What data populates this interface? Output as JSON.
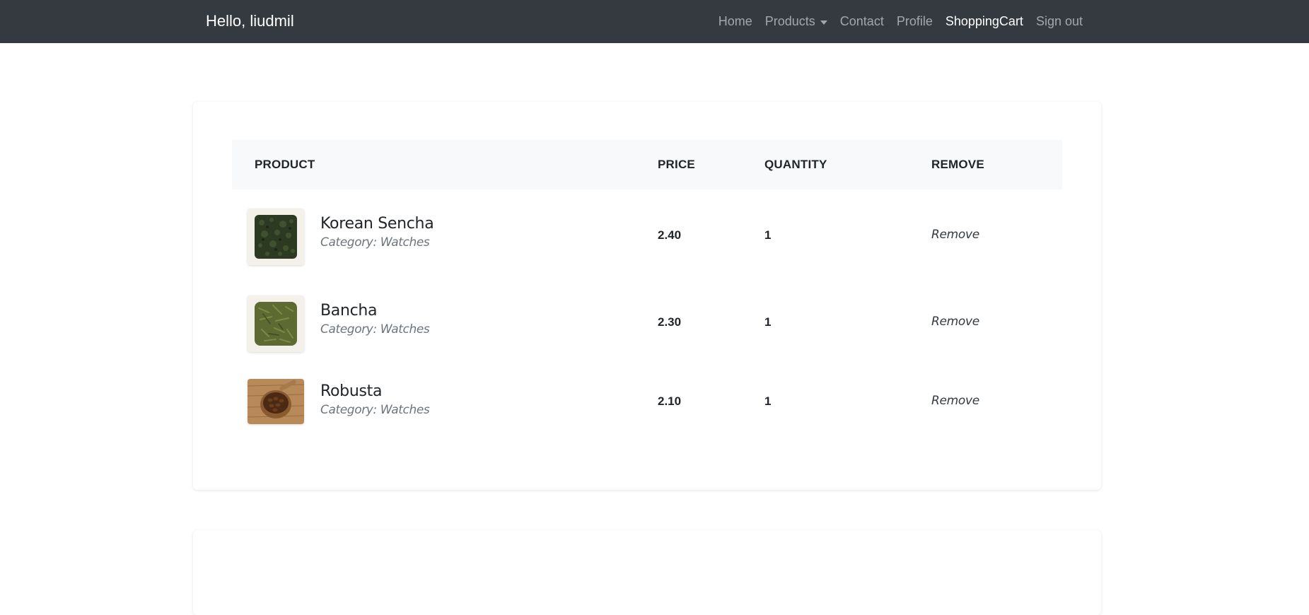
{
  "navbar": {
    "brand": "Hello, liudmil",
    "links": [
      {
        "label": "Home",
        "active": false
      },
      {
        "label": "Products",
        "active": false,
        "dropdown": true
      },
      {
        "label": "Contact",
        "active": false
      },
      {
        "label": "Profile",
        "active": false
      },
      {
        "label": "ShoppingCart",
        "active": true
      },
      {
        "label": "Sign out",
        "active": false
      }
    ]
  },
  "cart": {
    "columns": [
      "PRODUCT",
      "PRICE",
      "QUANTITY",
      "REMOVE"
    ],
    "items": [
      {
        "name": "Korean Sencha",
        "category": "Category: Watches",
        "price": "2.40",
        "quantity": "1",
        "remove": "Remove",
        "image": "dark-green-tea-leaves"
      },
      {
        "name": "Bancha",
        "category": "Category: Watches",
        "price": "2.30",
        "quantity": "1",
        "remove": "Remove",
        "image": "olive-green-tea-leaves"
      },
      {
        "name": "Robusta",
        "category": "Category: Watches",
        "price": "2.10",
        "quantity": "1",
        "remove": "Remove",
        "image": "coffee-beans-in-bowl"
      }
    ]
  },
  "colors": {
    "navbar_bg": "#343a40",
    "table_header_bg": "#f8f9fa",
    "muted_text": "#6c757d"
  }
}
